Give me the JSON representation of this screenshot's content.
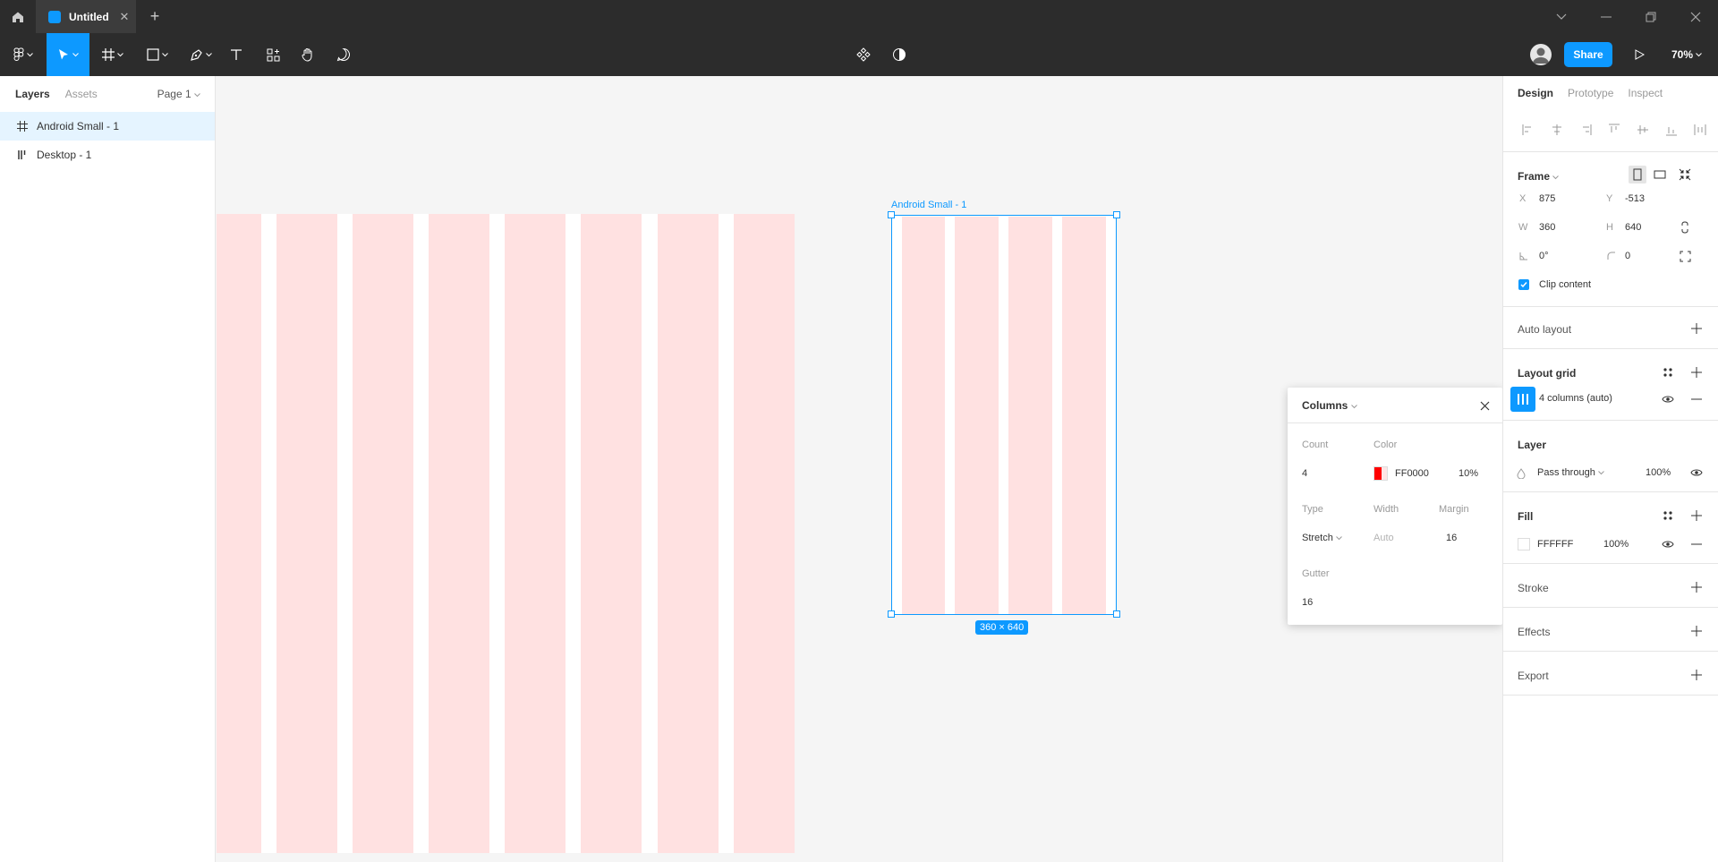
{
  "titlebar": {
    "tab_title": "Untitled",
    "new_tab": "+",
    "close": "✕"
  },
  "toolbar": {
    "share_label": "Share",
    "zoom_label": "70%"
  },
  "left_panel": {
    "tabs": [
      "Layers",
      "Assets"
    ],
    "page": "Page 1",
    "layers": [
      {
        "name": "Android Small - 1",
        "icon": "frame-icon",
        "selected": true
      },
      {
        "name": "Desktop - 1",
        "icon": "grid-columns-icon",
        "selected": false
      }
    ]
  },
  "canvas": {
    "frame_label": "Android Small - 1",
    "size_badge": "360 × 640"
  },
  "grid_popover": {
    "title": "Columns",
    "count_label": "Count",
    "count_value": "4",
    "color_label": "Color",
    "color_hex": "FF0000",
    "color_opacity": "10%",
    "type_label": "Type",
    "type_value": "Stretch",
    "width_label": "Width",
    "width_value": "Auto",
    "margin_label": "Margin",
    "margin_value": "16",
    "gutter_label": "Gutter",
    "gutter_value": "16"
  },
  "right_panel": {
    "tabs": [
      "Design",
      "Prototype",
      "Inspect"
    ],
    "frame": {
      "title": "Frame",
      "x_label": "X",
      "x": "875",
      "y_label": "Y",
      "y": "-513",
      "w_label": "W",
      "w": "360",
      "h_label": "H",
      "h": "640",
      "rotation": "0°",
      "radius": "0",
      "clip_label": "Clip content"
    },
    "auto_layout": "Auto layout",
    "layout_grid": {
      "title": "Layout grid",
      "item": "4 columns (auto)"
    },
    "layer": {
      "title": "Layer",
      "blend": "Pass through",
      "opacity": "100%"
    },
    "fill": {
      "title": "Fill",
      "hex": "FFFFFF",
      "opacity": "100%"
    },
    "stroke": "Stroke",
    "effects": "Effects",
    "export": "Export"
  },
  "colors": {
    "accent": "#0d99ff",
    "toolbar_bg": "#2c2c2c",
    "grid_column": "#ffe1e1"
  }
}
